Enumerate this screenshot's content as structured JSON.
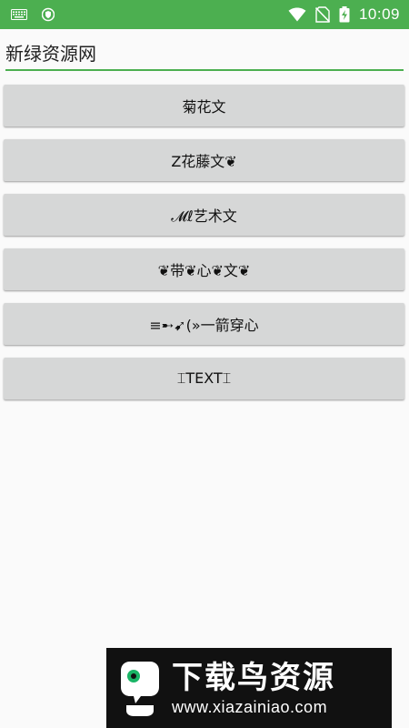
{
  "status_bar": {
    "time": "10:09",
    "icons": [
      "keyboard-icon",
      "shield-icon",
      "wifi-icon",
      "no-sim-icon",
      "battery-charging-icon"
    ],
    "background": "#4caf50"
  },
  "header": {
    "input_value": "新绿资源网",
    "accent": "#4caf50"
  },
  "buttons": [
    {
      "label": "菊花文"
    },
    {
      "label": "Z花藤文❦"
    },
    {
      "label": "𝓜ℓ艺术文"
    },
    {
      "label": "❦带❦心❦文❦"
    },
    {
      "label": "≡➸➹(»一箭穿心"
    },
    {
      "label": "⌶TEXT⌶"
    }
  ],
  "watermark": {
    "title": "下载鸟资源",
    "url": "www.xiazainiao.com"
  }
}
